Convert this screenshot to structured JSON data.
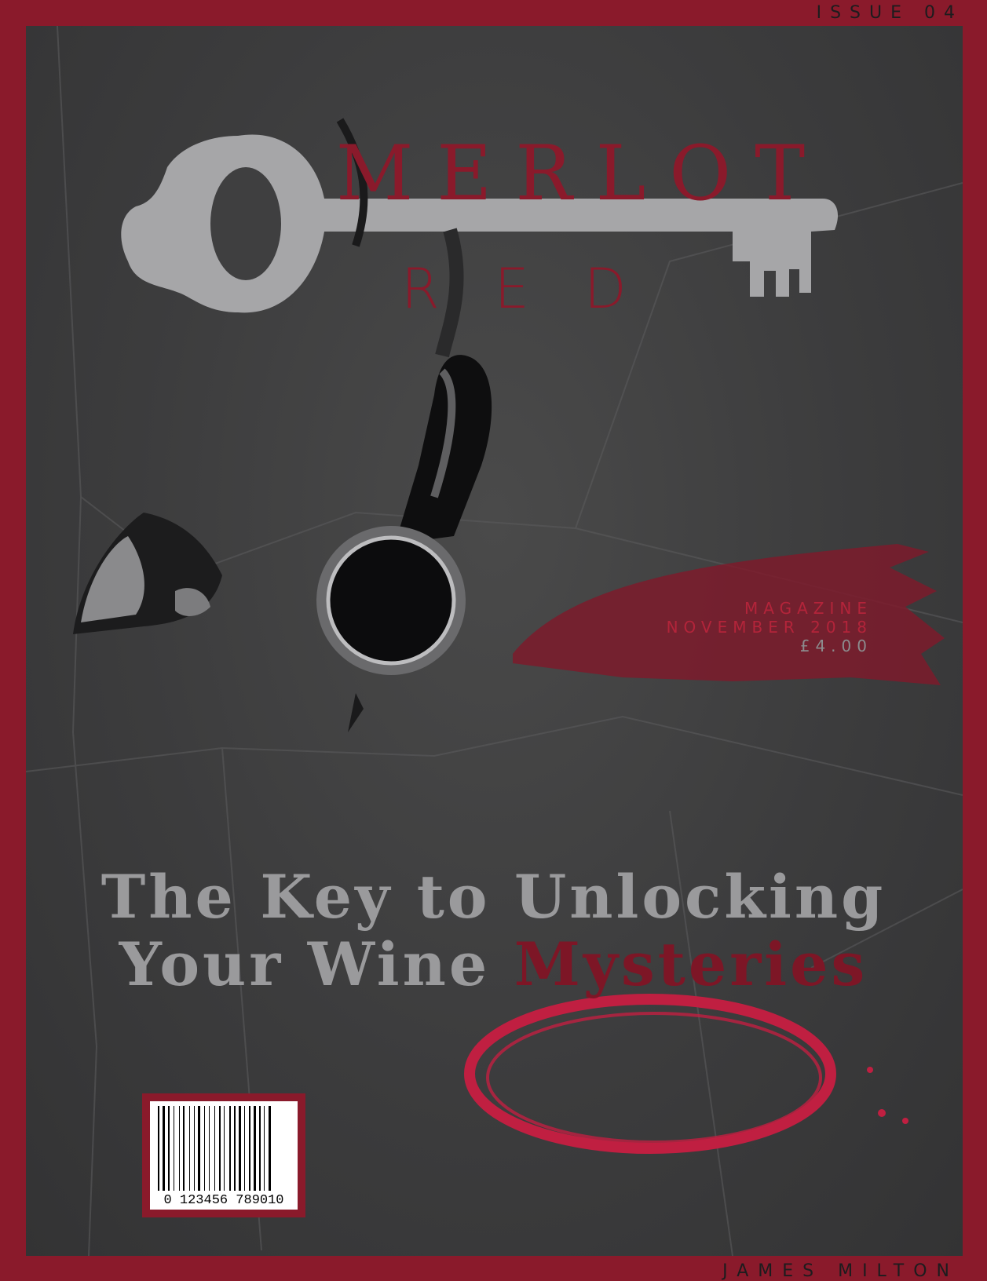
{
  "cover": {
    "issue": "ISSUE 04",
    "title_line1": "MERLOT",
    "title_line2": "RED",
    "info": {
      "magazine": "MAGAZINE",
      "date": "NOVEMBER 2018",
      "price": "£4.00"
    },
    "headline": {
      "line1": "The Key to Unlocking",
      "line2_start": "Your Wine",
      "line2_accent": "Mysteries"
    },
    "barcode_number": "0  123456  789010",
    "author": "JAMES MILTON"
  },
  "colors": {
    "frame": "#8a1a2b",
    "background": "#3c3c3d",
    "key": "#a6a6a8",
    "headline": "#9a9a9c",
    "accent": "#7d1626",
    "stain": "#c01f41"
  }
}
